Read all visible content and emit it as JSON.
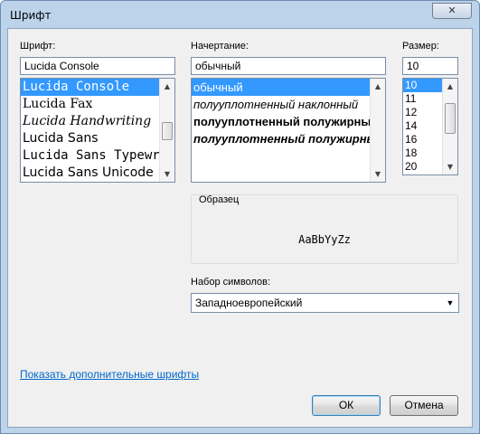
{
  "window": {
    "title": "Шрифт",
    "close_glyph": "✕"
  },
  "font": {
    "label": "Шрифт:",
    "value": "Lucida Console",
    "items": [
      {
        "label": "Lucida Console",
        "family": "\"DejaVu Sans Mono\", monospace",
        "style": "normal",
        "weight": "normal"
      },
      {
        "label": "Lucida Fax",
        "family": "\"DejaVu Serif\", serif",
        "style": "normal",
        "weight": "normal"
      },
      {
        "label": "Lucida Handwriting",
        "family": "\"DejaVu Serif\", serif",
        "style": "italic",
        "weight": "normal"
      },
      {
        "label": "Lucida Sans",
        "family": "\"DejaVu Sans\", sans-serif",
        "style": "normal",
        "weight": "normal"
      },
      {
        "label": "Lucida Sans Typewriter",
        "family": "\"DejaVu Sans Mono\", monospace",
        "style": "normal",
        "weight": "normal"
      },
      {
        "label": "Lucida Sans Unicode",
        "family": "\"DejaVu Sans\", sans-serif",
        "style": "normal",
        "weight": "normal"
      }
    ],
    "selected_index": 0,
    "scroll_position": 0.52
  },
  "style": {
    "label": "Начертание:",
    "value": "обычный",
    "items": [
      {
        "label": "обычный",
        "style": "normal",
        "weight": "normal"
      },
      {
        "label": "полууплотненный наклонный",
        "style": "italic",
        "weight": "normal"
      },
      {
        "label": "полууплотненный полужирный",
        "style": "normal",
        "weight": "bold"
      },
      {
        "label": "полууплотненный полужирный наклонный",
        "style": "italic",
        "weight": "bold"
      }
    ],
    "selected_index": 0
  },
  "size": {
    "label": "Размер:",
    "value": "10",
    "items": [
      "10",
      "11",
      "12",
      "14",
      "16",
      "18",
      "20"
    ],
    "selected_index": 0,
    "scroll_position": 0.25
  },
  "sample": {
    "legend": "Образец",
    "text": "AaBbYyZz"
  },
  "charset": {
    "label": "Набор символов:",
    "value": "Западноевропейский"
  },
  "link": {
    "more_fonts": "Показать дополнительные шрифты"
  },
  "buttons": {
    "ok": "ОК",
    "cancel": "Отмена"
  },
  "colors": {
    "selection": "#3399ff",
    "link": "#0066cc",
    "frame": "#bcd3ea"
  }
}
